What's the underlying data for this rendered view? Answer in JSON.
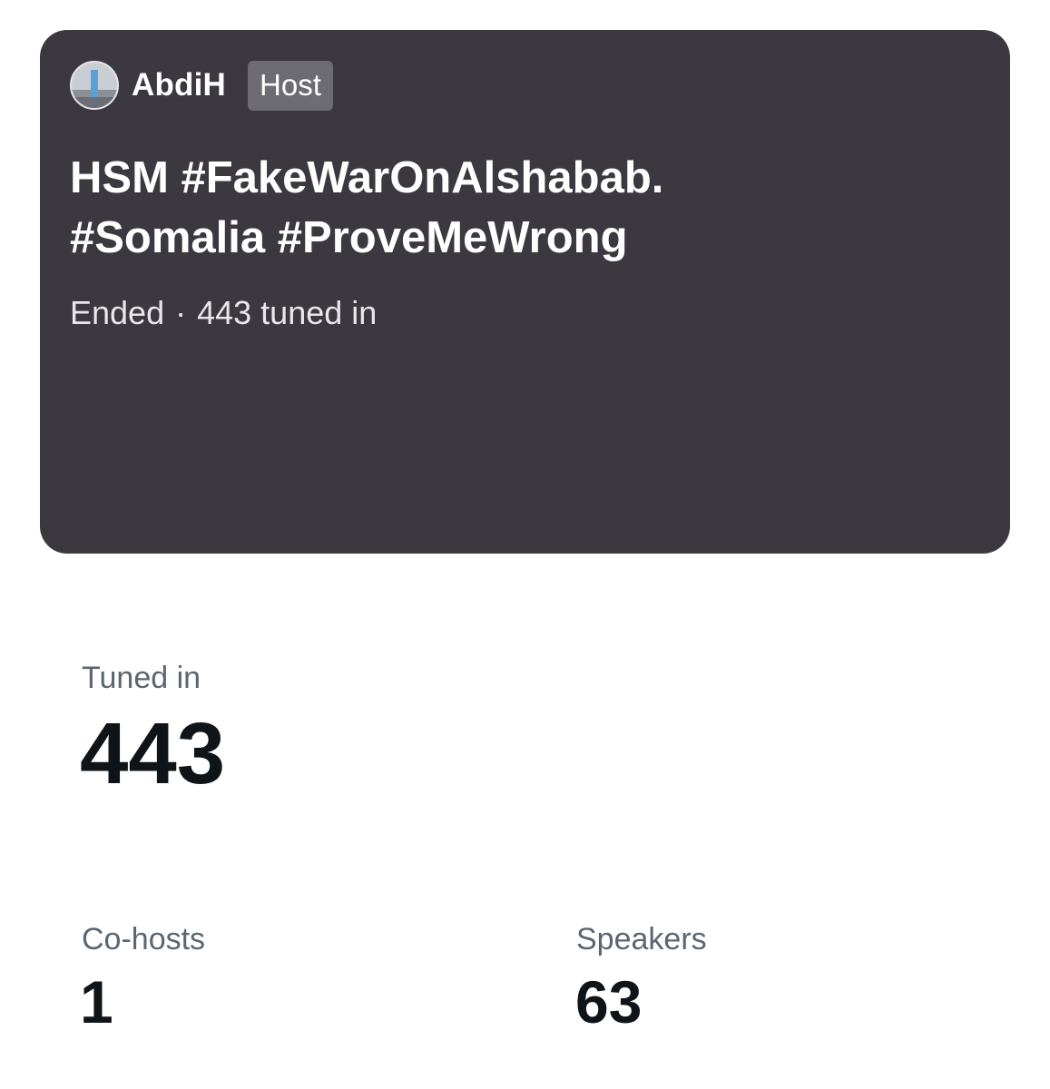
{
  "space": {
    "host_name": "AbdiH",
    "host_badge": "Host",
    "title_line1": "HSM #FakeWarOnAlshabab.",
    "title_line2": "#Somalia #ProveMeWrong",
    "status": "Ended",
    "separator": "·",
    "tuned_in_text": "443 tuned in",
    "card_color": "#3b383f"
  },
  "stats": {
    "tuned_in_label": "Tuned in",
    "tuned_in_value": "443",
    "cohosts_label": "Co-hosts",
    "cohosts_value": "1",
    "speakers_label": "Speakers",
    "speakers_value": "63"
  },
  "icons": {
    "avatar": "avatar-icon"
  }
}
